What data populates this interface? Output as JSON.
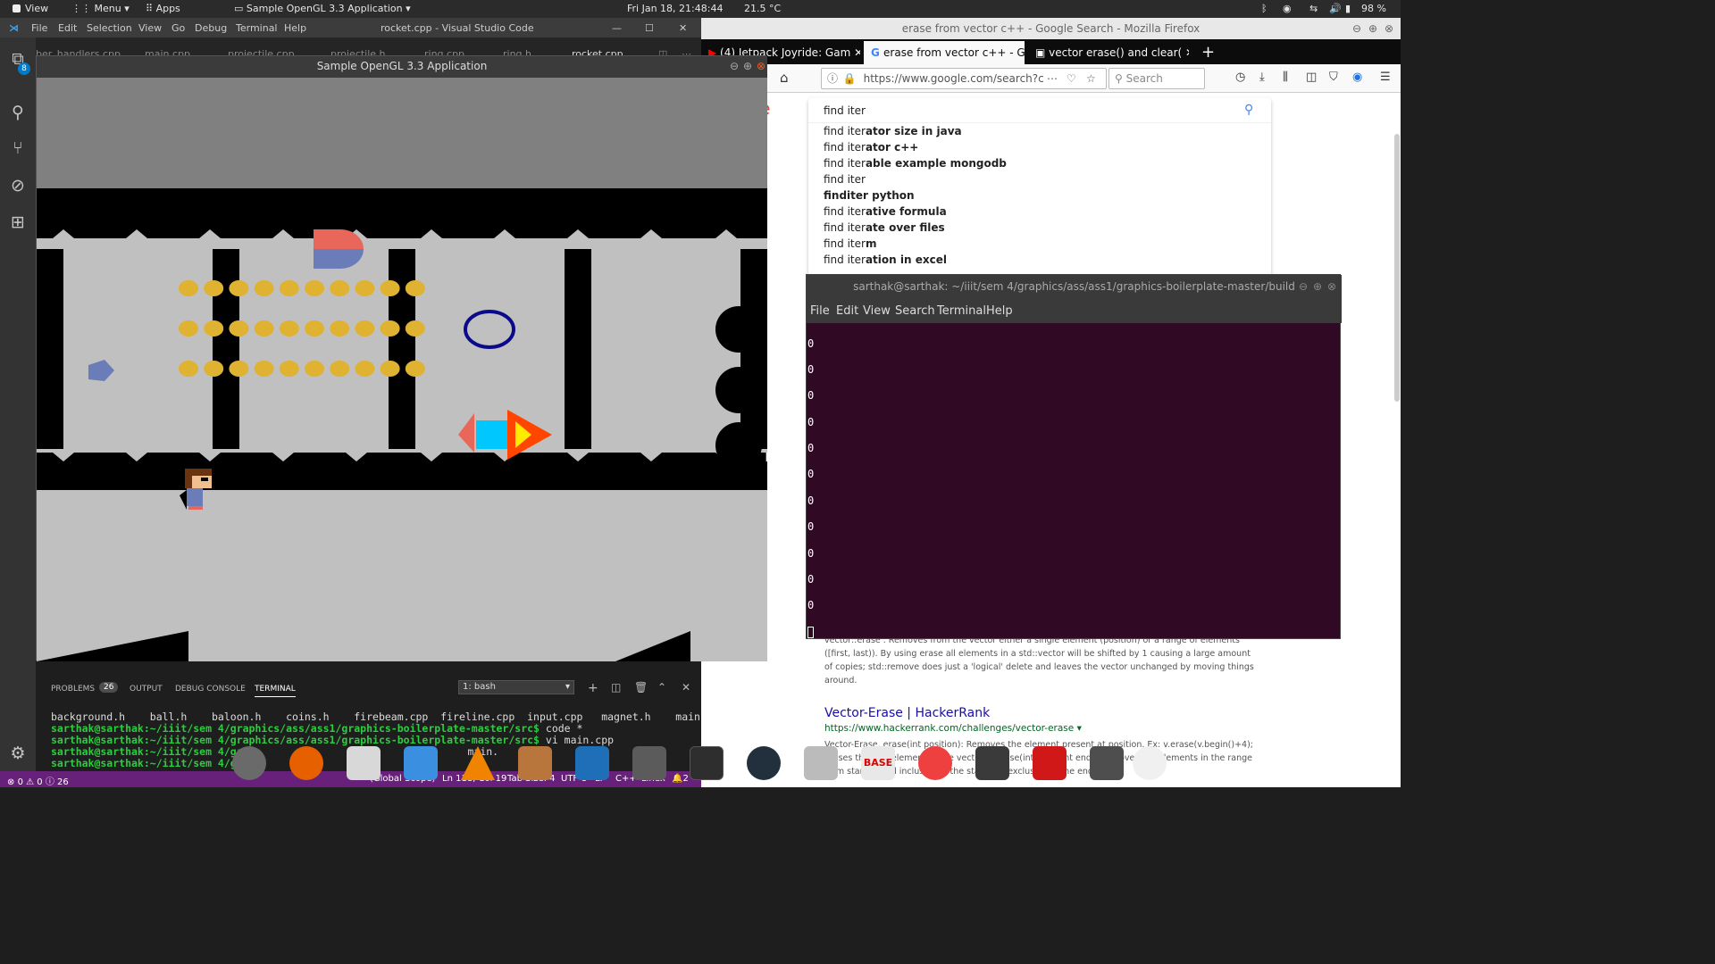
{
  "top_panel": {
    "view_label": "View",
    "menu_label": "Menu",
    "apps_label": "Apps",
    "active_app": "Sample OpenGL 3.3 Application",
    "datetime": "Fri Jan 18, 21:48:44",
    "temperature": "21.5 °C",
    "battery": "98 %"
  },
  "vscode": {
    "window_title": "rocket.cpp - Visual Studio Code",
    "menu": [
      "File",
      "Edit",
      "Selection",
      "View",
      "Go",
      "Debug",
      "Terminal",
      "Help"
    ],
    "badge_count": "8",
    "tabs": [
      "ber_handlers.cpp",
      "main.cpp",
      "projectile.cpp",
      "projectile.h",
      "ring.cpp",
      "ring.h",
      "rocket.cpp"
    ],
    "panel": {
      "tabs": [
        "PROBLEMS",
        "OUTPUT",
        "DEBUG CONSOLE",
        "TERMINAL"
      ],
      "problems_count": "26",
      "terminal_select": "1: bash"
    },
    "terminal_lines": {
      "files": "background.h    ball.h    baloon.h    coins.h    firebeam.cpp  fireline.cpp  input.cpp   magnet.h    main.h",
      "prompt1": "sarthak@sarthak:~/iiit/sem 4/graphics/ass/ass1/graphics-boilerplate-master/src$",
      "cmd1": " code *",
      "prompt2": "sarthak@sarthak:~/iiit/sem 4/graphics/ass/ass1/graphics-boilerplate-master/src$",
      "cmd2": " vi main.cpp",
      "prompt3": "sarthak@sarthak:~/iiit/sem 4/grap",
      "cmd3": "main.",
      "prompt4": "sarthak@sarthak:~/iiit/sem 4/grap"
    },
    "status": {
      "errors": "0",
      "warnings": "0",
      "info": "26",
      "scope": "(Global Scope)",
      "position": "Ln 118, Col 19",
      "tab_size": "Tab Size: 4",
      "encoding": "UTF-8",
      "eol": "LF",
      "language": "C++",
      "platform": "Linux",
      "notifications": "2"
    }
  },
  "game": {
    "title": "Sample OpenGL 3.3 Application"
  },
  "firefox": {
    "window_title": "erase from vector c++ - Google Search - Mozilla Firefox",
    "tabs": [
      "(4) Jetpack Joyride: Gam",
      "erase from vector c++ - G",
      "vector erase() and clear("
    ],
    "url": "https://www.google.com/search?c",
    "search_placeholder": "Search",
    "google_query": "find iter",
    "suggestions": [
      {
        "prefix": "find iter",
        "suffix": "ator size in java"
      },
      {
        "prefix": "find iter",
        "suffix": "ator c++"
      },
      {
        "prefix": "find iter",
        "suffix": "able example mongodb"
      },
      {
        "prefix": "find iter",
        "suffix": ""
      },
      {
        "prefix": "",
        "suffix": "finditer python"
      },
      {
        "prefix": "find iter",
        "suffix": "ative formula"
      },
      {
        "prefix": "find iter",
        "suffix": "ate over files"
      },
      {
        "prefix": "find iter",
        "suffix": "m"
      },
      {
        "prefix": "find iter",
        "suffix": "ation in excel"
      }
    ],
    "result_snippet_1": "vector::erase . Removes from the vector either a single element (position) or a range of elements ([first, last)). By using erase all elements in a std::vector will be shifted by 1 causing a large amount of copies; std::remove does just a 'logical' delete and leaves the vector unchanged by moving things around.",
    "result2_title": "Vector-Erase | HackerRank",
    "result2_url": "https://www.hackerrank.com/challenges/vector-erase",
    "result2_snippet": "Vector-Erase. erase(int position): Removes the element present at position. Ex: v.erase(v.begin()+4); erases the fifth element of the vector v. erase(int start, int end): Removes the elements in the range from start to end inclusive of the start and exclusive of the end."
  },
  "terminal": {
    "title": "sarthak@sarthak: ~/iiit/sem 4/graphics/ass/ass1/graphics-boilerplate-master/build",
    "menu": [
      "File",
      "Edit",
      "View",
      "Search",
      "Terminal",
      "Help"
    ],
    "output": [
      "0",
      "0",
      "0",
      "0",
      "0",
      "0",
      "0",
      "0",
      "0",
      "0",
      "0"
    ]
  },
  "dock": {
    "items": [
      "system-settings",
      "firefox",
      "installer",
      "finder",
      "vlc",
      "gimp",
      "vscode",
      "settings",
      "terminal",
      "stacer",
      "disks",
      "base",
      "vector-app",
      "notes",
      "pdf",
      "screen",
      "pinwheel"
    ]
  },
  "colors": {
    "vs_status": "#68217a",
    "terminal_bg": "#300a24",
    "coin": "#e0b232",
    "rocket_body": "#00c8ff",
    "rocket_tip": "#ff4500",
    "ring": "#0a0a8a",
    "magnet_top": "#e8675a",
    "magnet_bottom": "#6a7db8"
  }
}
